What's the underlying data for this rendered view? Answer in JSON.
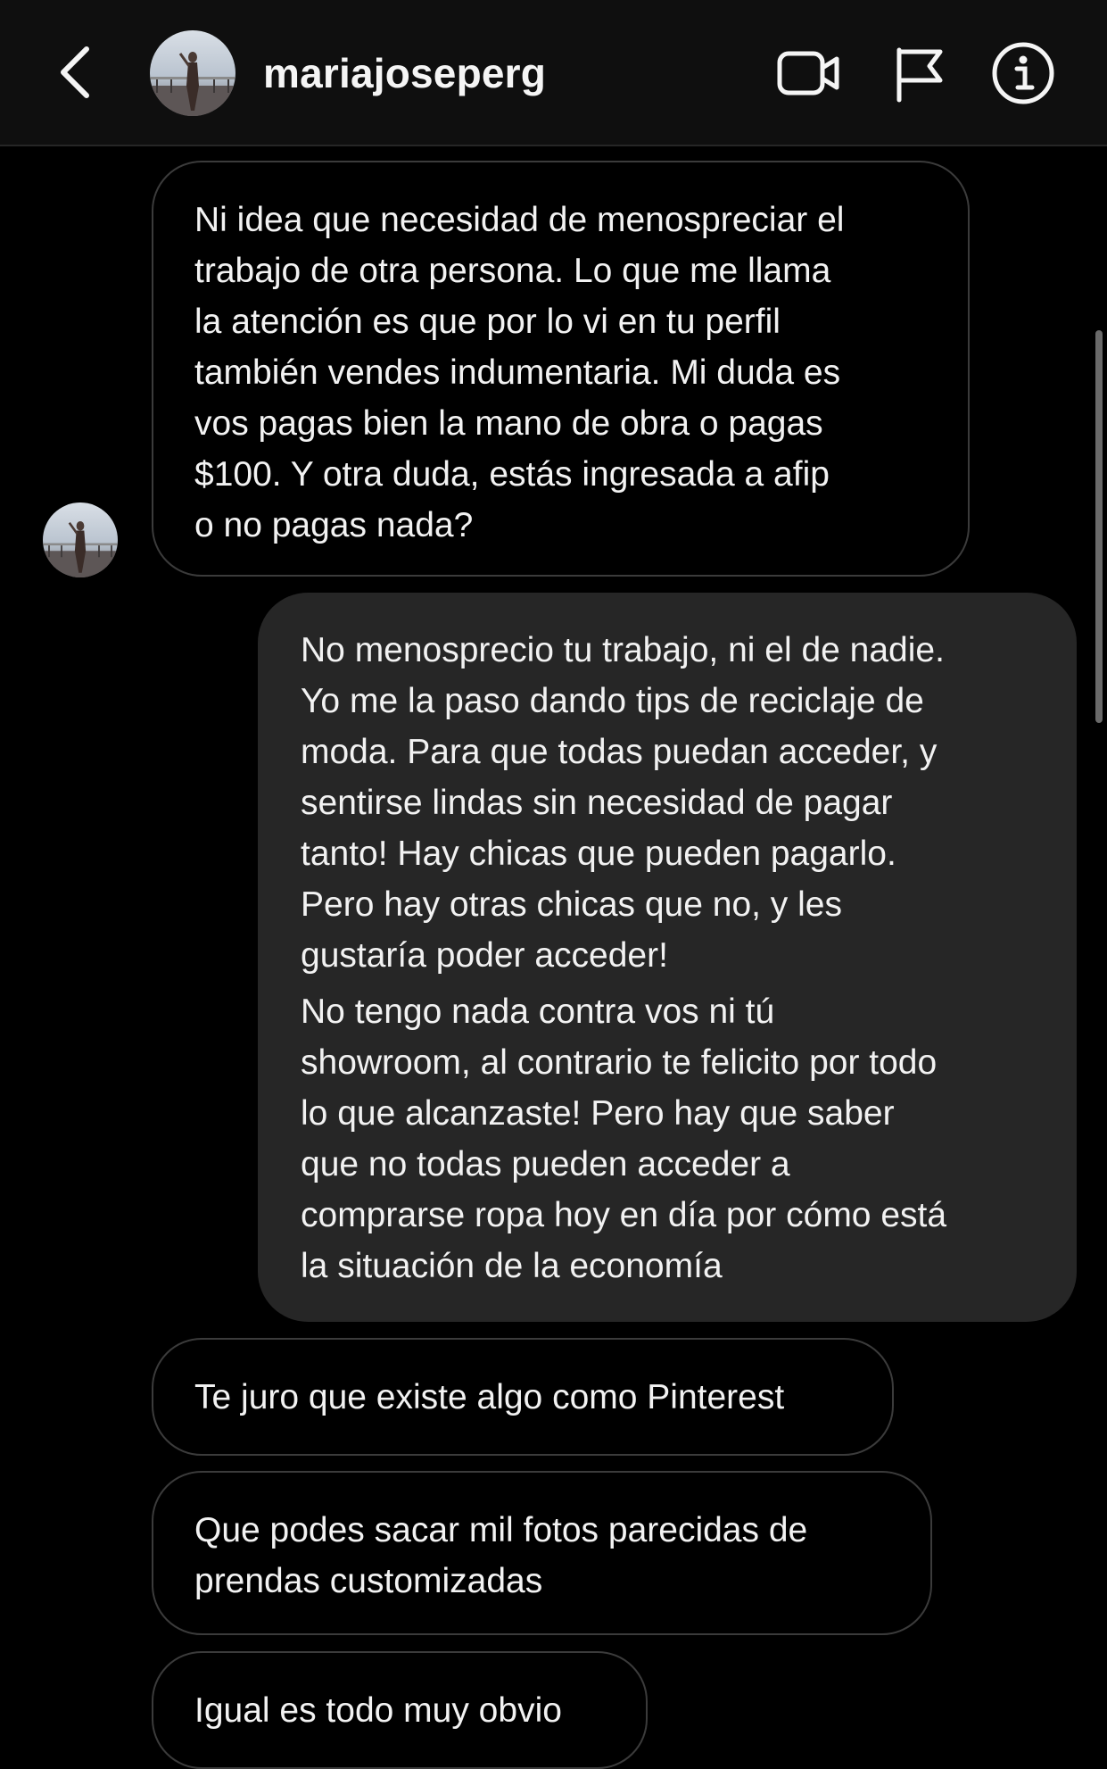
{
  "header": {
    "username": "mariajoseperg",
    "back_icon": "chevron-left-icon",
    "avatar_icon": "profile-photo",
    "actions": [
      {
        "name": "video-call",
        "icon": "video-camera-icon"
      },
      {
        "name": "report",
        "icon": "flag-icon"
      },
      {
        "name": "info",
        "icon": "info-circle-icon"
      }
    ]
  },
  "messages": [
    {
      "sender": "them",
      "paragraphs": [
        "Ni idea que necesidad de menospreciar el\ntrabajo de otra persona. Lo que me llama\nla atención es que por lo vi en tu perfil\ntambién vendes indumentaria. Mi duda es\nvos pagas bien la mano de obra o pagas\n$100. Y otra duda, estás ingresada a afip\no no pagas nada?"
      ]
    },
    {
      "sender": "me",
      "paragraphs": [
        "No menosprecio tu trabajo, ni el de nadie.\nYo me la paso dando tips de reciclaje de\nmoda. Para que todas puedan acceder, y\nsentirse lindas sin necesidad de pagar\ntanto! Hay chicas que pueden pagarlo.\nPero hay otras chicas que no, y les\ngustaría poder acceder!",
        "No tengo nada contra vos ni tú\nshowroom, al contrario te felicito por todo\nlo que alcanzaste! Pero hay que saber\nque no todas pueden acceder a\ncomprarse ropa hoy en día por cómo está\nla situación de la economía"
      ]
    },
    {
      "sender": "them",
      "paragraphs": [
        "Te juro que existe algo como Pinterest"
      ]
    },
    {
      "sender": "them",
      "paragraphs": [
        "Que podes sacar mil fotos parecidas de\nprendas customizadas"
      ]
    },
    {
      "sender": "them",
      "paragraphs": [
        "Igual es todo muy obvio"
      ]
    }
  ],
  "colors": {
    "background": "#000000",
    "header_bg": "#0f0f0f",
    "incoming_border": "#3b3b3b",
    "outgoing_bubble": "#262626",
    "text": "#f2f2f2"
  }
}
